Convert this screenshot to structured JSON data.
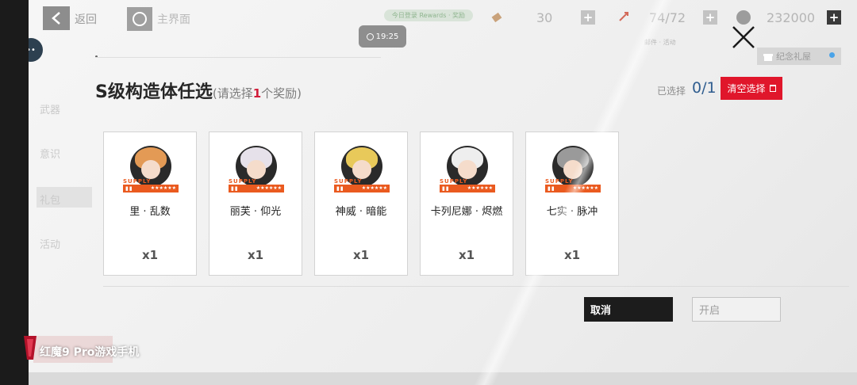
{
  "topbar": {
    "back_label": "返回",
    "home_label": "主界面",
    "pill_text": "今日登录 Rewards · 奖励",
    "res1_value": "30",
    "stamina_value": "74/72",
    "coin_value": "232000",
    "sub_note": "邮件 · 活动"
  },
  "status": {
    "clock": "19:25"
  },
  "gift_label": "纪念礼屋",
  "side_menu": [
    "武器",
    "意识",
    "礼包",
    "活动"
  ],
  "modal": {
    "title": "S级构造体任选",
    "hint_prefix": "(请选择",
    "hint_num": "1",
    "hint_suffix": "个奖励)",
    "selected_label": "已选择",
    "selected_count": "0/1",
    "clear_label": "清空选择",
    "cancel_label": "取消",
    "open_label": "开启"
  },
  "rewards": [
    {
      "name": "里 · 乱数",
      "qty": "x1",
      "tag": "SUPPLY",
      "hair": "#e39a55"
    },
    {
      "name": "丽芙 · 仰光",
      "qty": "x1",
      "tag": "SUPPLY",
      "hair": "#e6e1ea"
    },
    {
      "name": "神威 · 暗能",
      "qty": "x1",
      "tag": "SUPPLY",
      "hair": "#e8c95a"
    },
    {
      "name": "卡列尼娜 · 烬燃",
      "qty": "x1",
      "tag": "SUPPLY",
      "hair": "#eeeeee"
    },
    {
      "name": "七实 · 脉冲",
      "qty": "x1",
      "tag": "SUPPLY",
      "hair": "#9a9a9a"
    }
  ],
  "watermark": "红魔9 Pro游戏手机",
  "colors": {
    "accent_red": "#e0162b",
    "supply_orange": "#ea5a1f",
    "count_blue": "#2f5d8f"
  }
}
